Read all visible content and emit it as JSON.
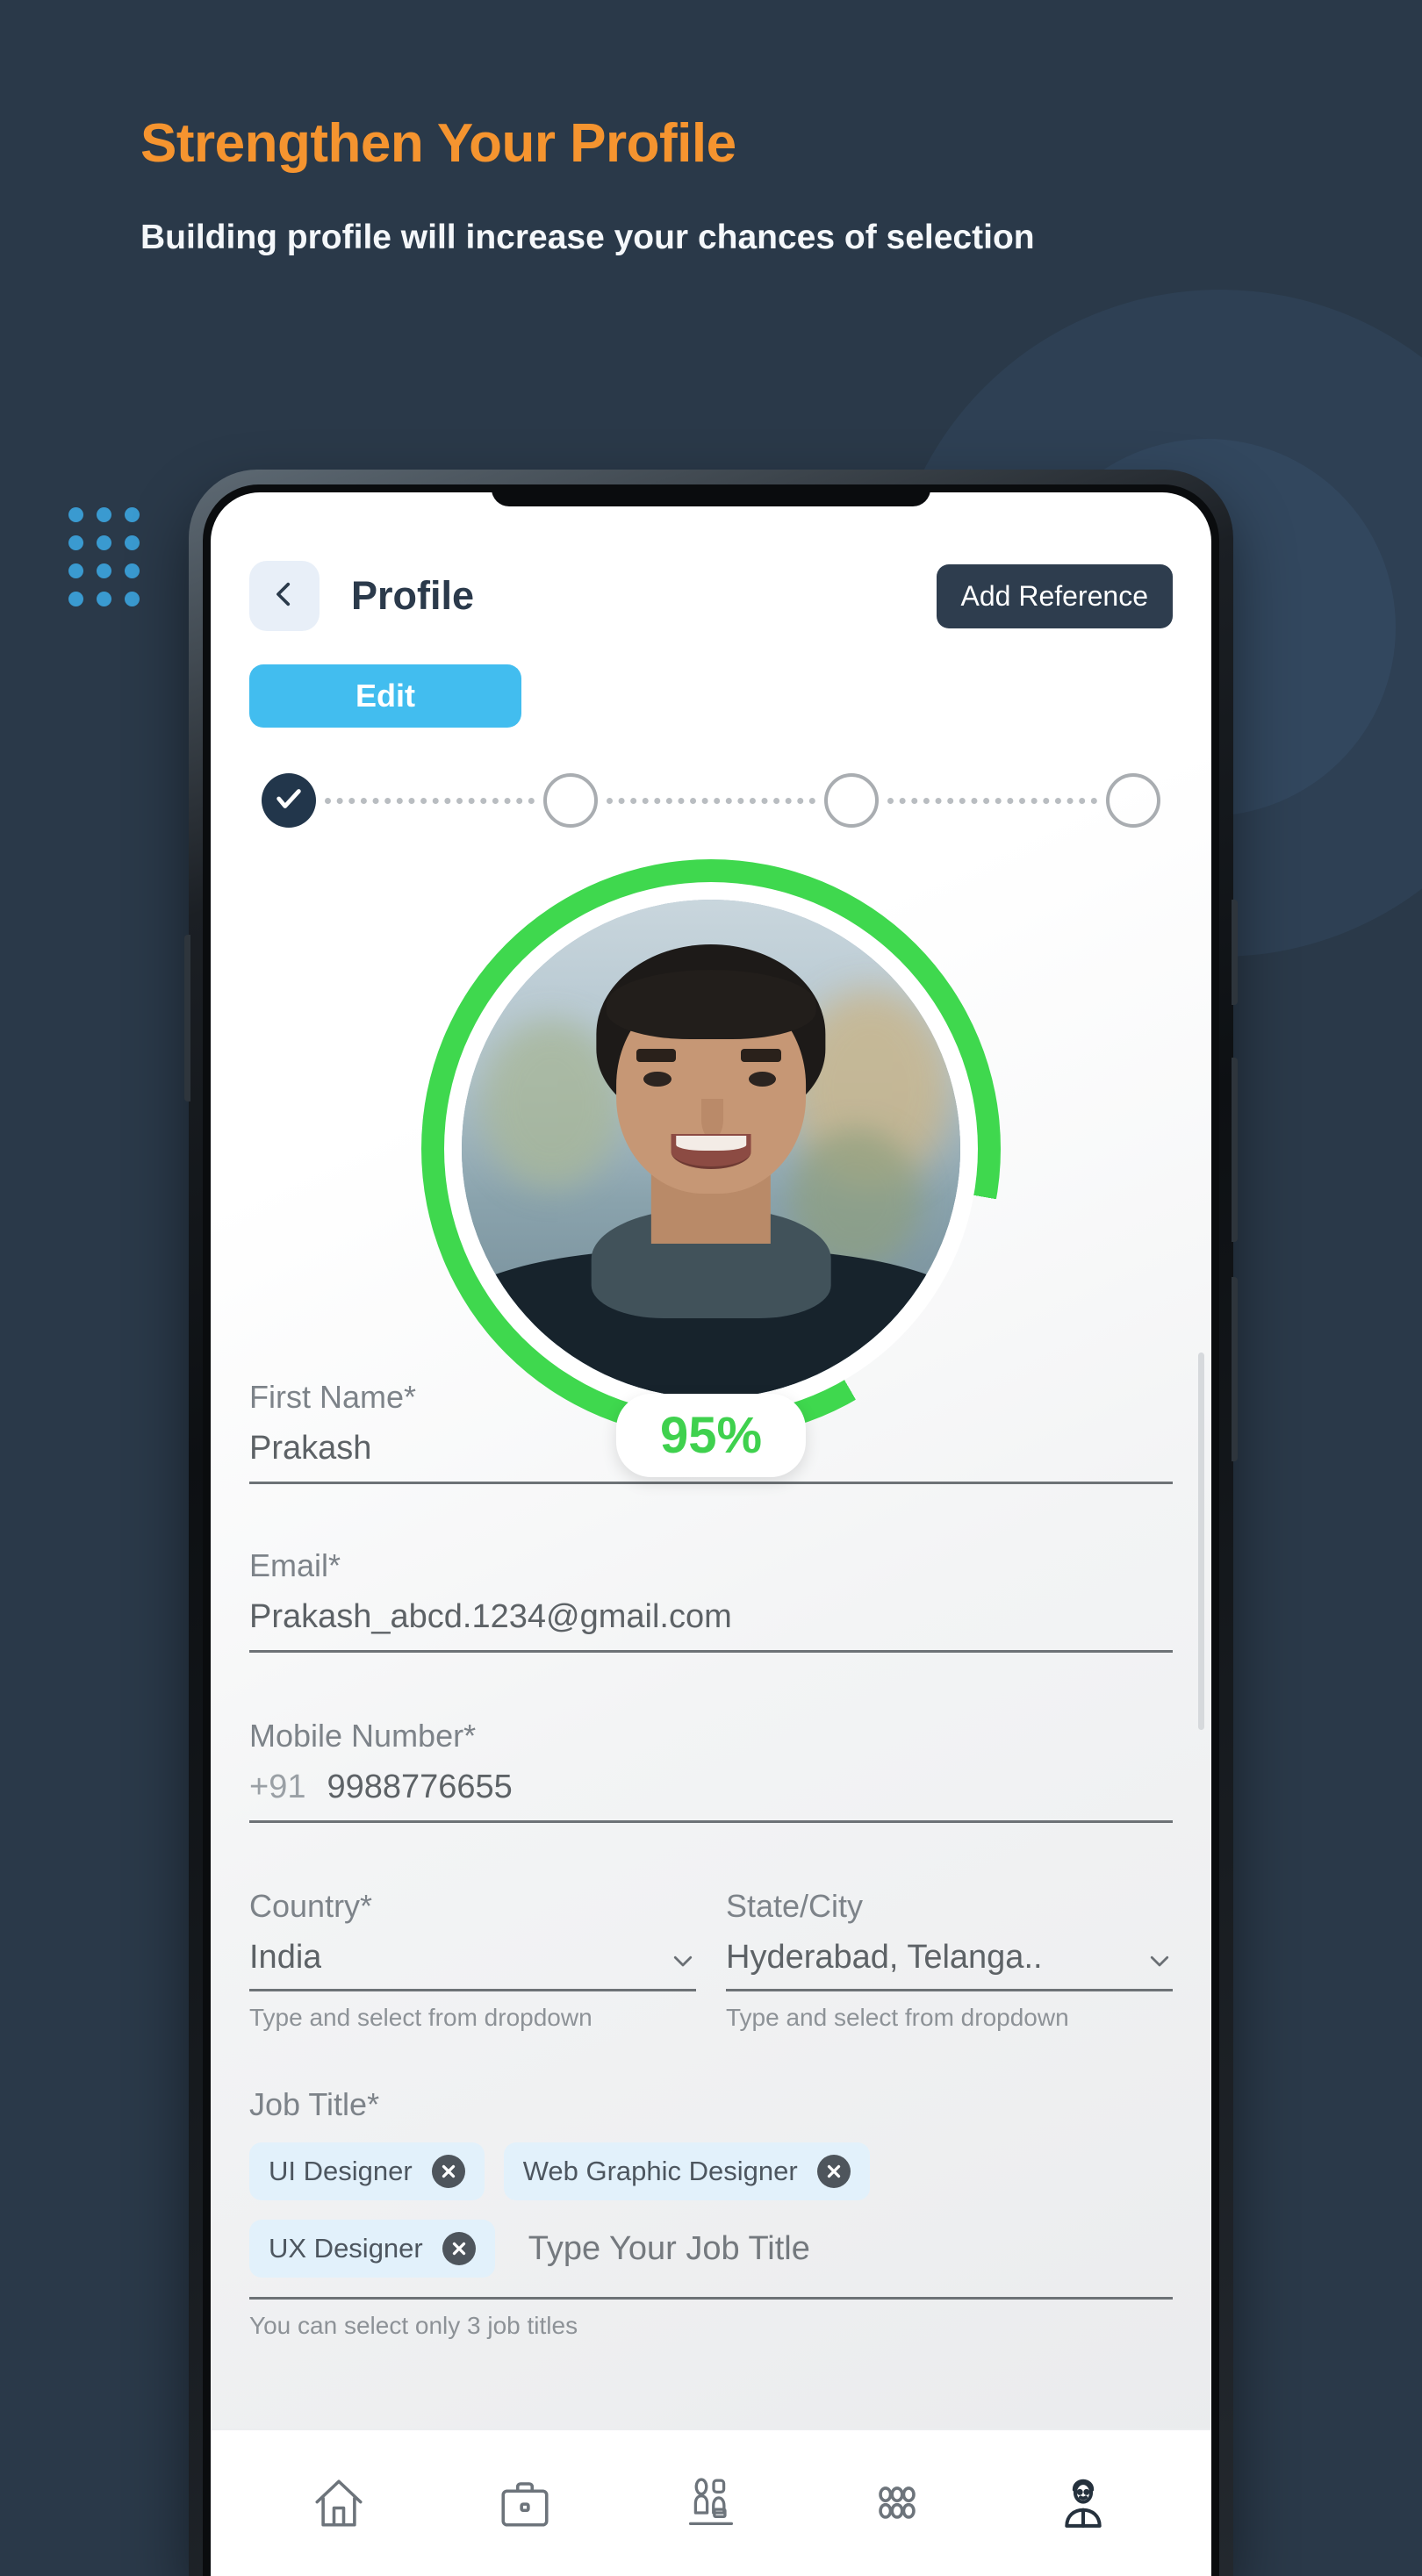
{
  "promo": {
    "headline": "Strengthen Your Profile",
    "subhead": "Building profile will increase your chances of selection"
  },
  "app": {
    "header": {
      "back_icon": "chevron-left-icon",
      "title": "Profile",
      "add_reference_label": "Add Reference"
    },
    "edit_button_label": "Edit",
    "stepper": {
      "total_steps": 4,
      "completed_steps": 1,
      "check_icon": "check-icon"
    },
    "avatar": {
      "completion_label": "95%",
      "completion_value": 95,
      "ring_color": "#3fd14e"
    },
    "form": {
      "first_name": {
        "label": "First Name*",
        "value": "Prakash"
      },
      "email": {
        "label": "Email*",
        "value": "Prakash_abcd.1234@gmail.com"
      },
      "mobile": {
        "label": "Mobile Number*",
        "country_code": "+91",
        "value": "9988776655"
      },
      "country": {
        "label": "Country*",
        "value": "India",
        "hint": "Type and select from dropdown",
        "chevron_icon": "chevron-down-icon"
      },
      "state_city": {
        "label": "State/City",
        "value": "Hyderabad, Telanga..",
        "hint": "Type and select from dropdown",
        "chevron_icon": "chevron-down-icon"
      },
      "job_title": {
        "label": "Job Title*",
        "chips": [
          {
            "label": "UI Designer",
            "remove_icon": "close-circle-icon"
          },
          {
            "label": "Web Graphic Designer",
            "remove_icon": "close-circle-icon"
          },
          {
            "label": "UX Designer",
            "remove_icon": "close-circle-icon"
          }
        ],
        "placeholder": "Type Your Job Title",
        "hint": "You can select only 3 job titles"
      }
    },
    "bottom_nav": [
      {
        "icon": "home-icon",
        "active": false
      },
      {
        "icon": "briefcase-icon",
        "active": false
      },
      {
        "icon": "interview-icon",
        "active": false
      },
      {
        "icon": "people-group-icon",
        "active": false
      },
      {
        "icon": "profile-person-icon",
        "active": true
      }
    ]
  },
  "colors": {
    "background": "#2a3949",
    "accent_orange": "#f5942f",
    "accent_blue": "#42bdef",
    "dot_blue": "#3a9ad0",
    "dark_navy": "#2e3d4e",
    "green": "#3fd14e",
    "chip_bg": "#e2f1fb"
  }
}
